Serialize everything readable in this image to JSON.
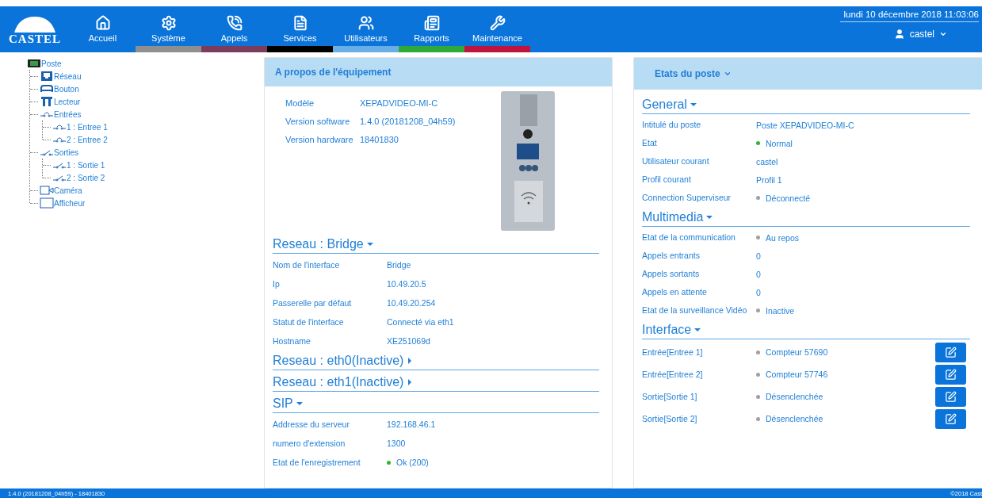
{
  "header": {
    "logo": "CASTEL",
    "nav": [
      {
        "label": "Accueil"
      },
      {
        "label": "Système",
        "color": "#8f8f8f"
      },
      {
        "label": "Appels",
        "color": "#7d3c5a"
      },
      {
        "label": "Services",
        "color": "#000000"
      },
      {
        "label": "Utilisateurs",
        "color": "#6aaee8"
      },
      {
        "label": "Rapports",
        "color": "#2eaa3a"
      },
      {
        "label": "Maintenance",
        "color": "#c0143c"
      }
    ],
    "datetime": "lundi 10 décembre 2018 11:03:06",
    "user": "castel"
  },
  "tree": [
    {
      "label": "Poste",
      "kind": "station",
      "children": [
        {
          "label": "Réseau",
          "kind": "network"
        },
        {
          "label": "Bouton",
          "kind": "button"
        },
        {
          "label": "Lecteur",
          "kind": "reader"
        },
        {
          "label": "Entrées",
          "kind": "input",
          "children": [
            {
              "label": "1 : Entree 1",
              "kind": "input"
            },
            {
              "label": "2 : Entree 2",
              "kind": "input"
            }
          ]
        },
        {
          "label": "Sorties",
          "kind": "output",
          "children": [
            {
              "label": "1 : Sortie 1",
              "kind": "output"
            },
            {
              "label": "2 : Sortie 2",
              "kind": "output"
            }
          ]
        },
        {
          "label": "Caméra",
          "kind": "camera"
        },
        {
          "label": "Afficheur",
          "kind": "display"
        }
      ]
    }
  ],
  "about": {
    "title": "A propos de l'équipement",
    "rows": [
      {
        "label": "Modèle",
        "value": "XEPADVIDEO-MI-C"
      },
      {
        "label": "Version software",
        "value": "1.4.0 (20181208_04h59)"
      },
      {
        "label": "Version hardware",
        "value": "18401830"
      }
    ],
    "sections": [
      {
        "title": "Reseau : Bridge",
        "expanded": true,
        "rows": [
          {
            "label": "Nom de l'interface",
            "value": "Bridge"
          },
          {
            "label": "Ip",
            "value": "10.49.20.5"
          },
          {
            "label": "Passerelle par défaut",
            "value": "10.49.20.254"
          },
          {
            "label": "Statut de l'interface",
            "value": "Connecté via eth1"
          },
          {
            "label": "Hostname",
            "value": "XE251069d"
          }
        ]
      },
      {
        "title": "Reseau : eth0(Inactive)",
        "expanded": false
      },
      {
        "title": "Reseau : eth1(Inactive)",
        "expanded": false
      },
      {
        "title": "SIP",
        "expanded": true,
        "rows": [
          {
            "label": "Addresse du serveur",
            "value": "192.168.46.1"
          },
          {
            "label": "numero d'extension",
            "value": "1300"
          },
          {
            "label": "Etat de l'enregistrement",
            "value": "Ok (200)",
            "color": "#2eb82e"
          }
        ]
      }
    ]
  },
  "status": {
    "title": "Etats du poste",
    "sections": [
      {
        "title": "General",
        "expanded": true,
        "rows": [
          {
            "label": "Intitulé du poste",
            "value": "Poste XEPADVIDEO-MI-C"
          },
          {
            "label": "Etat",
            "value": "Normal",
            "color": "#2eb82e"
          },
          {
            "label": "Utilisateur courant",
            "value": "castel"
          },
          {
            "label": "Profil courant",
            "value": "Profil 1"
          },
          {
            "label": "Connection Superviseur",
            "value": "Déconnecté",
            "color": "#a0a0a0"
          }
        ]
      },
      {
        "title": "Multimedia",
        "expanded": true,
        "rows": [
          {
            "label": "Etat de la communication",
            "value": "Au repos",
            "color": "#a0a0a0"
          },
          {
            "label": "Appels entrants",
            "value": "0"
          },
          {
            "label": "Appels sortants",
            "value": "0"
          },
          {
            "label": "Appels en attente",
            "value": "0"
          },
          {
            "label": "Etat de la surveillance Vidéo",
            "value": "Inactive",
            "color": "#a0a0a0"
          }
        ]
      },
      {
        "title": "Interface",
        "expanded": true,
        "rows": [
          {
            "label": "Entrée[Entree 1]",
            "value": "Compteur 57690",
            "color": "#a0a0a0",
            "editable": true
          },
          {
            "label": "Entrée[Entree 2]",
            "value": "Compteur 57746",
            "color": "#a0a0a0",
            "editable": true
          },
          {
            "label": "Sortie[Sortie 1]",
            "value": "Désenclenchée",
            "color": "#a0a0a0",
            "editable": true
          },
          {
            "label": "Sortie[Sortie 2]",
            "value": "Désenclenchée",
            "color": "#a0a0a0",
            "editable": true
          }
        ]
      }
    ]
  },
  "footer": {
    "version": "1.4.0 (20181208_04h59) - 18401830",
    "copyright": "©2018 Cast"
  }
}
